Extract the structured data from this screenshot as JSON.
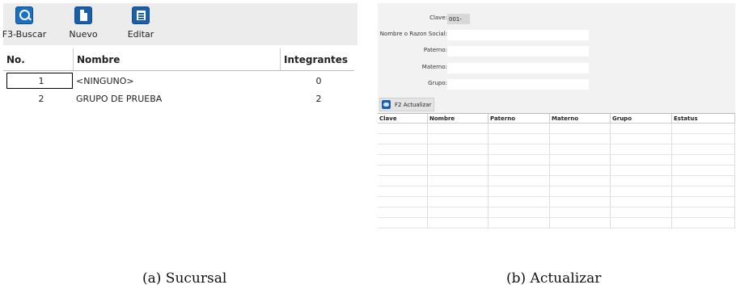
{
  "panel_a": {
    "toolbar": {
      "buttons": [
        {
          "label": "F3-Buscar",
          "icon": "search-icon"
        },
        {
          "label": "Nuevo",
          "icon": "new-document-icon"
        },
        {
          "label": "Editar",
          "icon": "edit-document-icon"
        }
      ]
    },
    "grid": {
      "columns": [
        "No.",
        "Nombre",
        "Integrantes"
      ],
      "rows": [
        {
          "no": "1",
          "nombre": "<NINGUNO>",
          "integrantes": "0"
        },
        {
          "no": "2",
          "nombre": "GRUPO DE PRUEBA",
          "integrantes": "2"
        }
      ]
    }
  },
  "panel_b": {
    "form": {
      "clave_label": "Clave:",
      "clave_value": "001-",
      "nombre_label": "Nombre o Razon Social:",
      "nombre_value": "",
      "paterno_label": "Paterno:",
      "paterno_value": "",
      "materno_label": "Materno:",
      "materno_value": "",
      "grupo_label": "Grupo:",
      "grupo_value": ""
    },
    "actualizar_button": {
      "label": "F2 Actualizar",
      "icon": "car-icon"
    },
    "grid": {
      "columns": [
        "Clave",
        "Nombre",
        "Paterno",
        "Materno",
        "Grupo",
        "Estatus"
      ]
    }
  },
  "captions": {
    "a": "(a)  Sucursal",
    "b": "(b)  Actualizar"
  },
  "colors": {
    "icon_blue": "#1b5fa8",
    "toolbar_bg": "#ececec",
    "form_bg": "#f2f2f2"
  }
}
